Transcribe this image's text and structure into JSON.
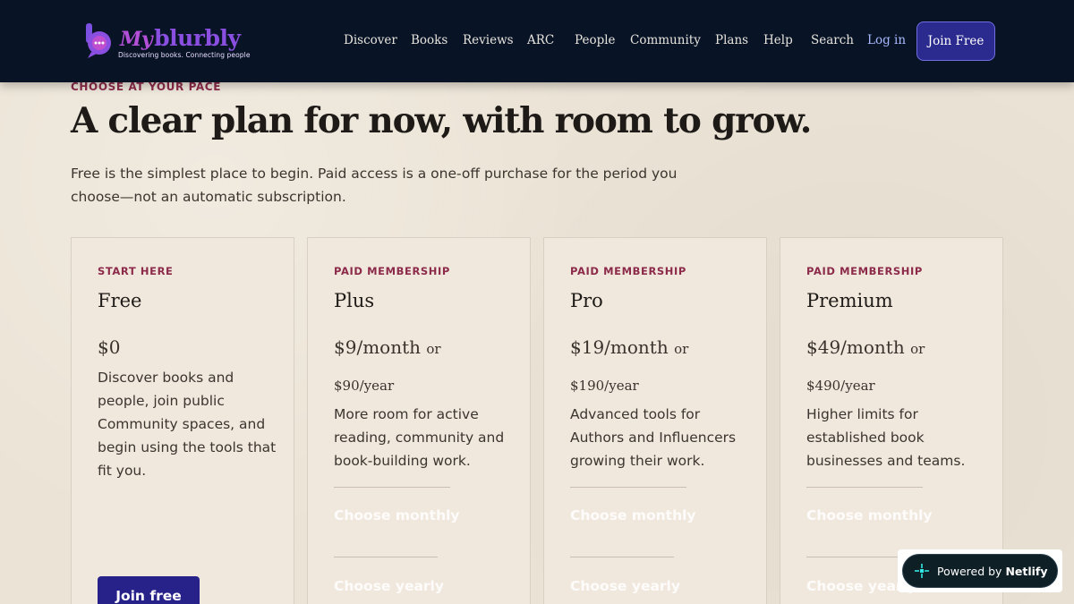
{
  "header": {
    "logo_word_prefix": "My",
    "logo_word": "blurbly",
    "logo_tagline": "Discovering books. Connecting people",
    "nav": [
      "Discover",
      "Books",
      "Reviews",
      "ARC",
      "People",
      "Community",
      "Plans",
      "Help",
      "Search"
    ],
    "login_label": "Log in",
    "join_label": "Join Free"
  },
  "hero": {
    "eyebrow": "CHOOSE AT YOUR PACE",
    "title": "A clear plan for now, with room to grow.",
    "subtitle": "Free is the simplest place to begin. Paid access is a one-off purchase for the period you choose—not an automatic subscription."
  },
  "plans": [
    {
      "eyebrow": "START HERE",
      "name": "Free",
      "price": "$0",
      "description": "Discover books and people, join public Community spaces, and begin using the tools that fit you.",
      "cta": "Join free"
    },
    {
      "eyebrow": "PAID MEMBERSHIP",
      "name": "Plus",
      "price_monthly": "$9/month",
      "or": "or",
      "price_yearly": "$90/year",
      "description": "More room for active reading, community and book-building work.",
      "monthly_cta": "Choose monthly",
      "yearly_cta": "Choose yearly"
    },
    {
      "eyebrow": "PAID MEMBERSHIP",
      "name": "Pro",
      "price_monthly": "$19/month",
      "or": "or",
      "price_yearly": "$190/year",
      "description": "Advanced tools for Authors and Influencers growing their work.",
      "monthly_cta": "Choose monthly",
      "yearly_cta": "Choose yearly"
    },
    {
      "eyebrow": "PAID MEMBERSHIP",
      "name": "Premium",
      "price_monthly": "$49/month",
      "or": "or",
      "price_yearly": "$490/year",
      "description": "Higher limits for established book businesses and teams.",
      "monthly_cta": "Choose monthly",
      "yearly_cta": "Choose yearly"
    }
  ],
  "badge": {
    "prefix": "Powered by",
    "brand": "Netlify",
    "icon": "netlify-icon"
  },
  "colors": {
    "header_bg": "#081426",
    "page_bg": "#ebe3d5",
    "accent_eyebrow": "#8c2a4a",
    "primary_button": "#27228a",
    "logo_purple": "#8a4fe0"
  }
}
